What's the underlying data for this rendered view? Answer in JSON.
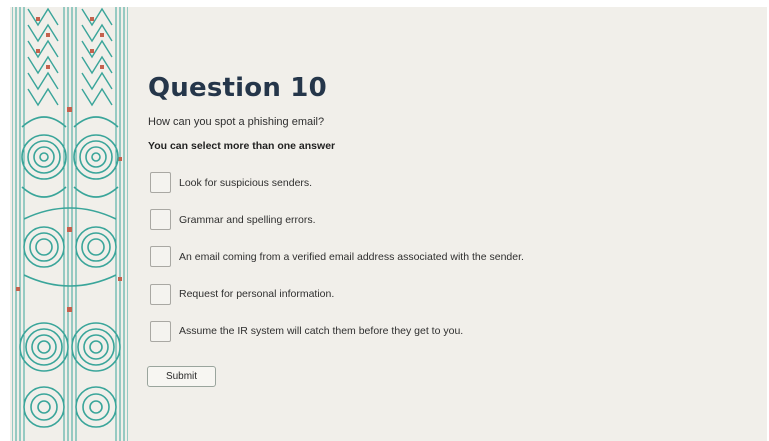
{
  "question": {
    "title": "Question 10",
    "prompt": "How can you spot a phishing email?",
    "instruction": "You can select more than one answer"
  },
  "options": [
    {
      "label": "Look for suspicious senders.",
      "checked": false
    },
    {
      "label": "Grammar and spelling errors.",
      "checked": false
    },
    {
      "label": "An email coming from a verified email address associated with the sender.",
      "checked": false
    },
    {
      "label": "Request for personal information.",
      "checked": false
    },
    {
      "label": "Assume the IR system will catch them before they get to you.",
      "checked": false
    }
  ],
  "submit_label": "Submit",
  "colors": {
    "background": "#f1efea",
    "title": "#25364a",
    "pattern_teal": "#3aa59a",
    "pattern_red": "#c4624e"
  },
  "decoration": "maori-kowhaiwhai-pattern"
}
